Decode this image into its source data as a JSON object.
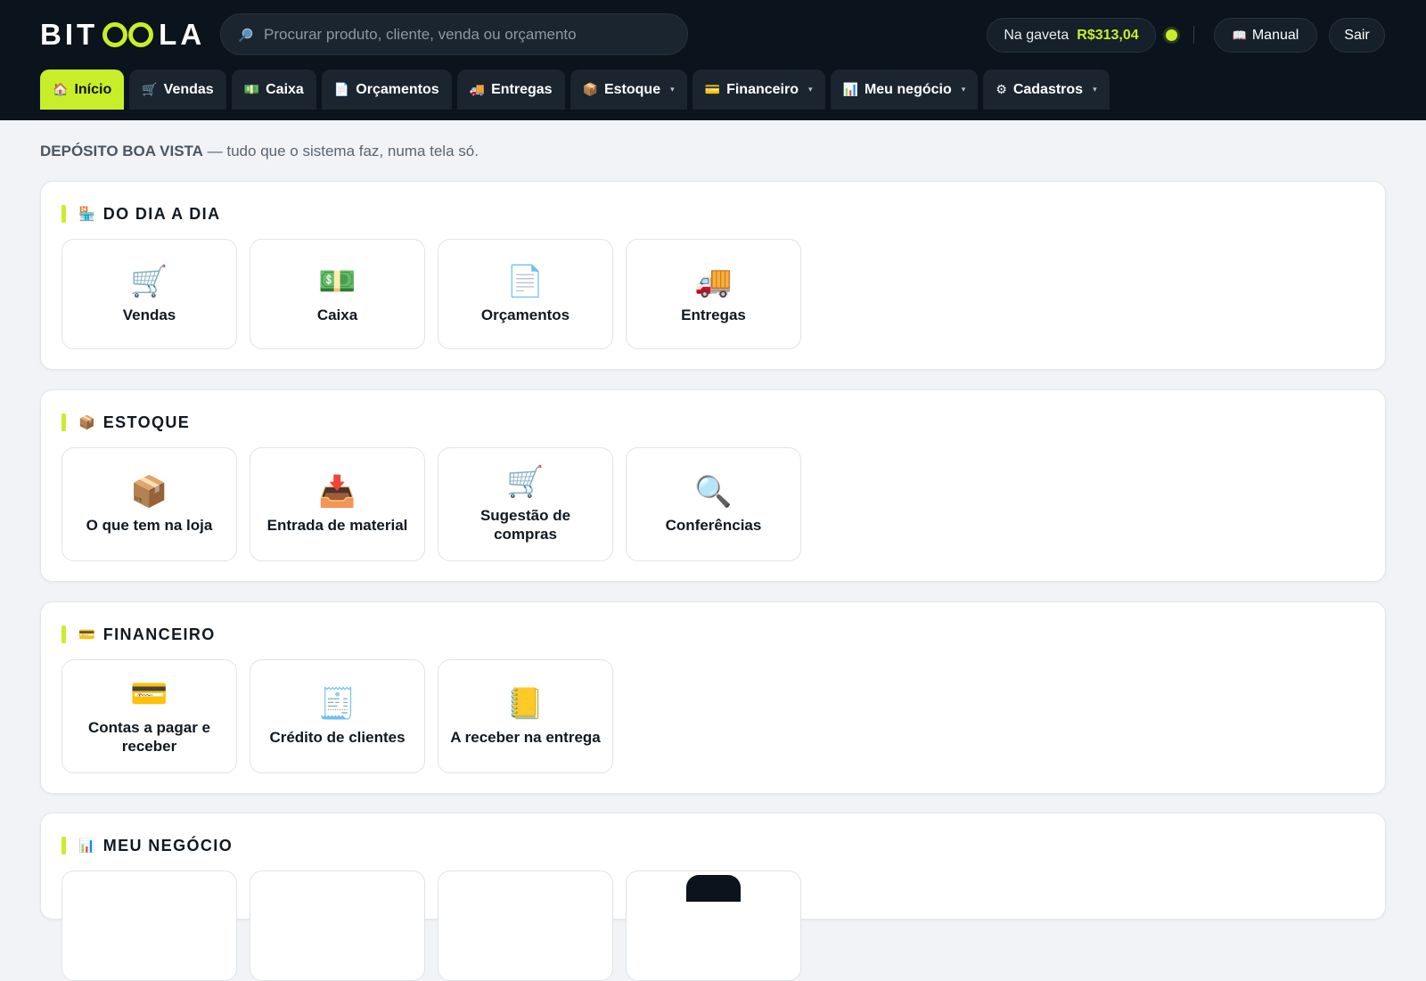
{
  "brand": {
    "name_left": "BIT",
    "name_right": "LA",
    "accent": "#c8ee2a",
    "dark": "#0b131c"
  },
  "search": {
    "placeholder": "Procurar produto, cliente, venda ou orçamento",
    "icon": "search-icon"
  },
  "drawer": {
    "label": "Na gaveta",
    "amount": "R$313,04"
  },
  "header_buttons": {
    "manual_icon": "📖",
    "manual_label": "Manual",
    "logout_label": "Sair"
  },
  "nav": {
    "tabs": [
      {
        "icon": "🏠",
        "label": "Início",
        "active": true,
        "dropdown": false
      },
      {
        "icon": "🛒",
        "label": "Vendas",
        "active": false,
        "dropdown": false
      },
      {
        "icon": "💵",
        "label": "Caixa",
        "active": false,
        "dropdown": false
      },
      {
        "icon": "📄",
        "label": "Orçamentos",
        "active": false,
        "dropdown": false
      },
      {
        "icon": "🚚",
        "label": "Entregas",
        "active": false,
        "dropdown": false
      },
      {
        "icon": "📦",
        "label": "Estoque",
        "active": false,
        "dropdown": true
      },
      {
        "icon": "💳",
        "label": "Financeiro",
        "active": false,
        "dropdown": true
      },
      {
        "icon": "📊",
        "label": "Meu negócio",
        "active": false,
        "dropdown": true
      },
      {
        "icon": "⚙",
        "label": "Cadastros",
        "active": false,
        "dropdown": true
      }
    ],
    "caret": "▾"
  },
  "subtitle": {
    "org": "DEPÓSITO BOA VISTA",
    "text": " — tudo que o sistema faz, numa tela só."
  },
  "sections": [
    {
      "icon": "🏪",
      "title": "DO DIA A DIA",
      "cards": [
        {
          "icon": "🛒",
          "label": "Vendas"
        },
        {
          "icon": "💵",
          "label": "Caixa"
        },
        {
          "icon": "📄",
          "label": "Orçamentos"
        },
        {
          "icon": "🚚",
          "label": "Entregas"
        }
      ]
    },
    {
      "icon": "📦",
      "title": "ESTOQUE",
      "cards": [
        {
          "icon": "📦",
          "label": "O que tem na loja"
        },
        {
          "icon": "📥",
          "label": "Entrada de material"
        },
        {
          "icon": "🛒",
          "label": "Sugestão de compras"
        },
        {
          "icon": "🔍",
          "label": "Conferências"
        }
      ]
    },
    {
      "icon": "💳",
      "title": "FINANCEIRO",
      "cards": [
        {
          "icon": "💳",
          "label": "Contas a pagar e receber"
        },
        {
          "icon": "🧾",
          "label": "Crédito de clientes"
        },
        {
          "icon": "📒",
          "label": "A receber na entrega"
        }
      ]
    },
    {
      "icon": "📊",
      "title": "MEU NEGÓCIO",
      "cards": []
    }
  ]
}
